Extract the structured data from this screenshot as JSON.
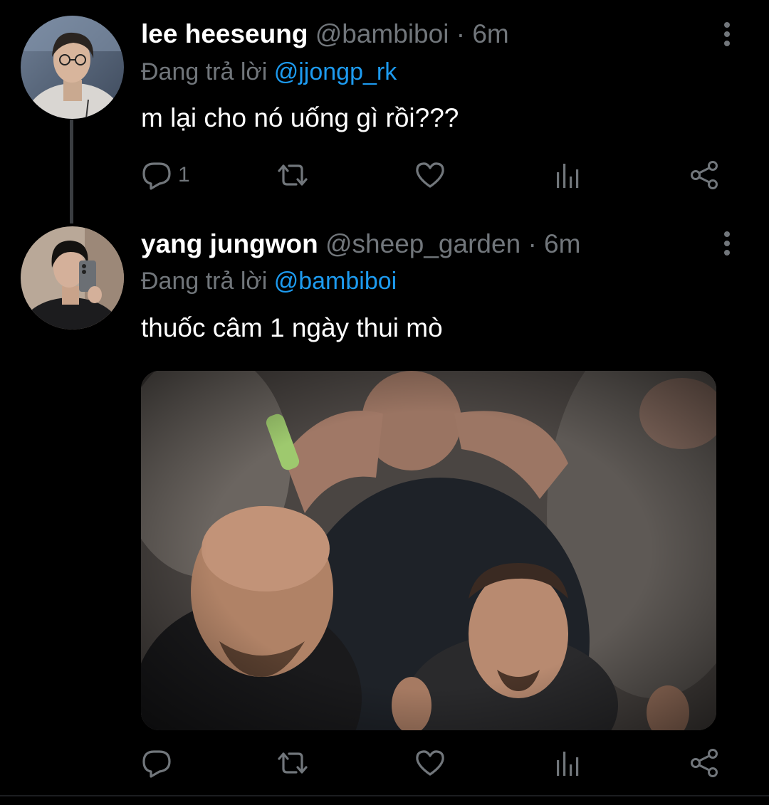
{
  "tweets": [
    {
      "display_name": "lee heeseung",
      "handle": "@bambiboi",
      "separator": "·",
      "time": "6m",
      "replying_prefix": "Đang trả lời",
      "replying_to": "@jjongp_rk",
      "text": "m lại cho nó uống gì rồi???",
      "reply_count": "1",
      "avatar": "avatar-photo"
    },
    {
      "display_name": "yang jungwon",
      "handle": "@sheep_garden",
      "separator": "·",
      "time": "6m",
      "replying_prefix": "Đang trả lời",
      "replying_to": "@bambiboi",
      "text": "thuốc câm 1 ngày thui mò",
      "reply_count": "",
      "avatar": "avatar-photo",
      "media": "attached-photo"
    }
  ],
  "icons": {
    "reply": "reply-icon",
    "retweet": "retweet-icon",
    "like": "like-icon",
    "analytics": "analytics-icon",
    "share": "share-icon",
    "more": "more-icon"
  },
  "colors": {
    "background": "#000000",
    "text": "#ffffff",
    "secondary": "#71767b",
    "mention": "#1d9bf0",
    "thread_line": "#3a3d41"
  }
}
